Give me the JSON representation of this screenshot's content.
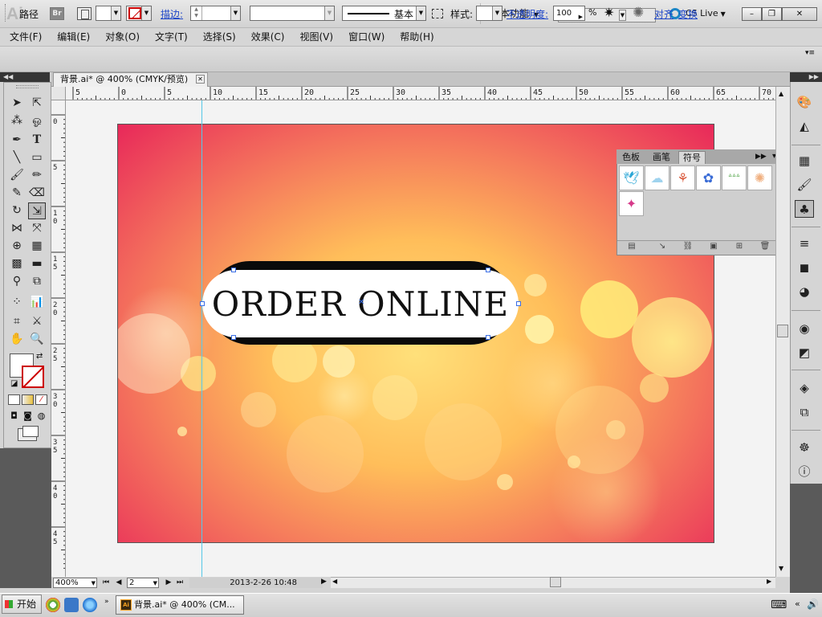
{
  "app": {
    "logo": "Ai",
    "bridge_label": "Br",
    "workspace_label": "基本功能",
    "cs_live_label": "CS Live",
    "window_buttons": {
      "minimize": "–",
      "maximize": "❐",
      "close": "✕"
    }
  },
  "menu": [
    "文件(F)",
    "编辑(E)",
    "对象(O)",
    "文字(T)",
    "选择(S)",
    "效果(C)",
    "视图(V)",
    "窗口(W)",
    "帮助(H)"
  ],
  "control_bar": {
    "selection_label": "路径",
    "stroke_label": "描边:",
    "brush_definition": "基本",
    "style_label": "样式:",
    "opacity_label": "不透明度:",
    "opacity_value": "100",
    "opacity_unit": "%",
    "align_label": "对齐",
    "transform_label": "变换"
  },
  "document": {
    "tab_title": "背景.ai* @ 400% (CMYK/预览)",
    "button_text": "ORDER ONLINE"
  },
  "ruler": {
    "top_labels": [
      "5",
      "0",
      "5",
      "10",
      "15",
      "20",
      "25",
      "30",
      "35",
      "40",
      "45",
      "50",
      "55",
      "60",
      "65",
      "70"
    ],
    "left_labels": [
      "0",
      "5",
      "10",
      "15",
      "20",
      "25",
      "30",
      "35",
      "40",
      "45"
    ]
  },
  "symbols_panel": {
    "tabs": [
      "色板",
      "画笔",
      "符号"
    ],
    "active_tab": "符号",
    "symbols": [
      {
        "name": "bird-symbol",
        "glyph": "🕊",
        "color": "#2aa6d6"
      },
      {
        "name": "cloud-symbol",
        "glyph": "☁",
        "color": "#9fd3ee"
      },
      {
        "name": "flower-symbol",
        "glyph": "⚘",
        "color": "#d9583a"
      },
      {
        "name": "blue-flower-symbol",
        "glyph": "✿",
        "color": "#3a6cd6"
      },
      {
        "name": "grass-symbol",
        "glyph": "ᐞᐞᐞ",
        "color": "#4aa040"
      },
      {
        "name": "dandelion-symbol",
        "glyph": "✺",
        "color": "#f0b080"
      },
      {
        "name": "sparkles-symbol",
        "glyph": "✦",
        "color": "#d63a8a"
      }
    ]
  },
  "status": {
    "zoom": "400%",
    "page": "2",
    "info": "2013-2-26  10:48"
  },
  "taskbar": {
    "start_label": "开始",
    "window_label": "背景.ai* @ 400% (CM..."
  },
  "colors": {
    "accent_link": "#1e46c8",
    "guide": "#56c8e8",
    "artboard_pink": "#e8285a",
    "artboard_yellow": "#ffe07a"
  }
}
